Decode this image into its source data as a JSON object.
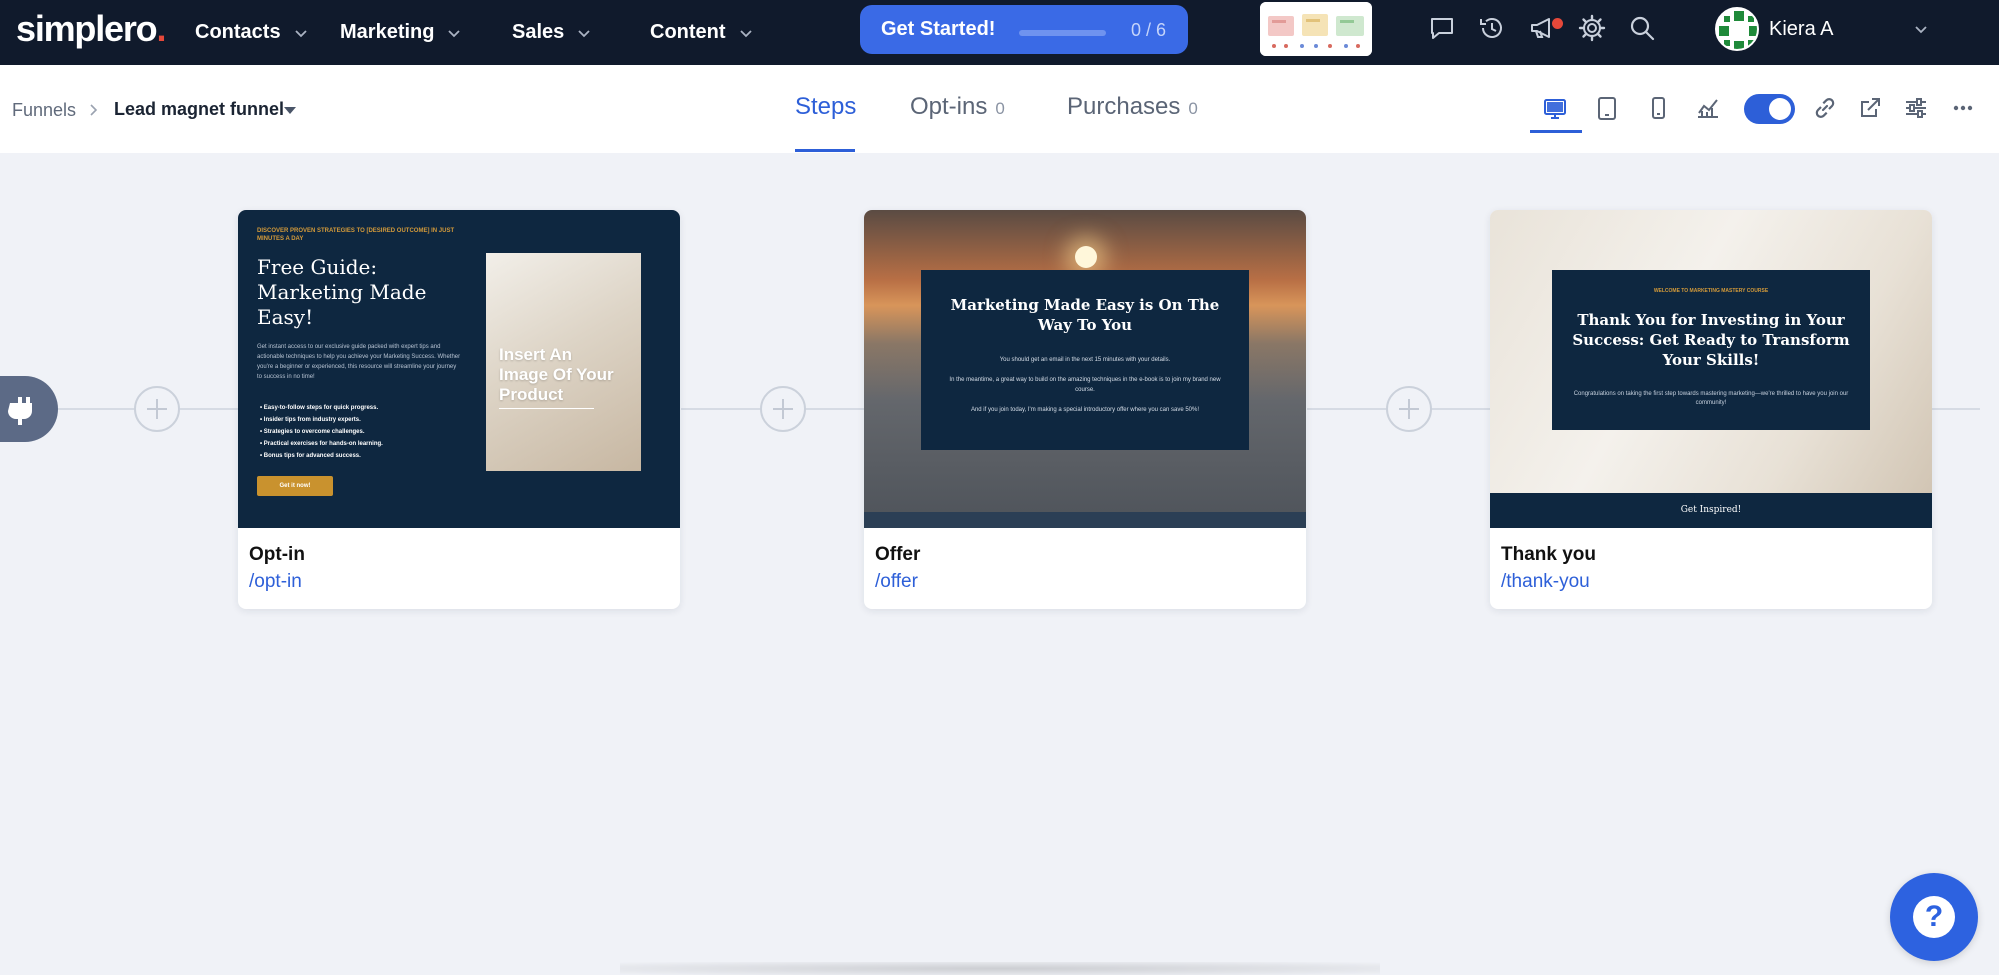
{
  "app": {
    "logo": "simplero",
    "logo_dot": "."
  },
  "nav": {
    "menus": [
      {
        "label": "Contacts"
      },
      {
        "label": "Marketing"
      },
      {
        "label": "Sales"
      },
      {
        "label": "Content"
      }
    ],
    "get_started": {
      "label": "Get Started!",
      "progress": "0 / 6",
      "progress_fraction": 0.0
    },
    "icons": [
      "chat-icon",
      "history-icon",
      "megaphone-icon",
      "gear-icon",
      "search-icon"
    ],
    "user": {
      "name": "Kiera A"
    }
  },
  "breadcrumb": {
    "root": "Funnels",
    "current": "Lead magnet funnel"
  },
  "tabs": [
    {
      "label": "Steps",
      "count": ""
    },
    {
      "label": "Opt-ins",
      "count": "0"
    },
    {
      "label": "Purchases",
      "count": "0"
    }
  ],
  "toolbar": {
    "icons": [
      "desktop-icon",
      "tablet-icon",
      "mobile-icon",
      "analytics-icon",
      "link-icon",
      "external-link-icon",
      "settings-sliders-icon",
      "more-icon"
    ],
    "toggle_on": true
  },
  "colors": {
    "nav_bg": "#101a2c",
    "accent": "#2d5fd8",
    "brand_red": "#e5483a",
    "preview_navy": "#0e2740",
    "gold": "#c9922e"
  },
  "steps": [
    {
      "name": "Opt-in",
      "path": "/opt-in",
      "preview": {
        "kicker": "DISCOVER PROVEN STRATEGIES TO [DESIRED OUTCOME] IN JUST MINUTES A DAY",
        "title": "Free Guide: Marketing Made Easy!",
        "body": "Get instant access to our exclusive guide packed with expert tips and actionable techniques to help you achieve your Marketing Success. Whether you're a beginner or experienced, this resource will streamline your journey to success in no time!",
        "bullets": [
          "Easy-to-follow steps for quick progress.",
          "Insider tips from industry experts.",
          "Strategies to overcome challenges.",
          "Practical exercises for hands-on learning.",
          "Bonus tips for advanced success."
        ],
        "button": "Get it now!",
        "image_text": "Insert An Image Of Your Product"
      }
    },
    {
      "name": "Offer",
      "path": "/offer",
      "preview": {
        "title": "Marketing Made Easy is On The Way To You",
        "lines": [
          "You should get an email in the next 15 minutes with your details.",
          "In the meantime, a great way to build on the amazing techniques in the e-book is to join my brand new course.",
          "And if you join today, I'm making a special introductory offer where you can save 50%!"
        ]
      }
    },
    {
      "name": "Thank you",
      "path": "/thank-you",
      "preview": {
        "kicker": "WELCOME TO MARKETING MASTERY COURSE",
        "title": "Thank You for Investing in Your Success: Get Ready to Transform Your Skills!",
        "text": "Congratulations on taking the first step towards mastering marketing—we're thrilled to have you join our community!",
        "footer": "Get Inspired!"
      }
    }
  ],
  "help": {
    "label": "?"
  }
}
